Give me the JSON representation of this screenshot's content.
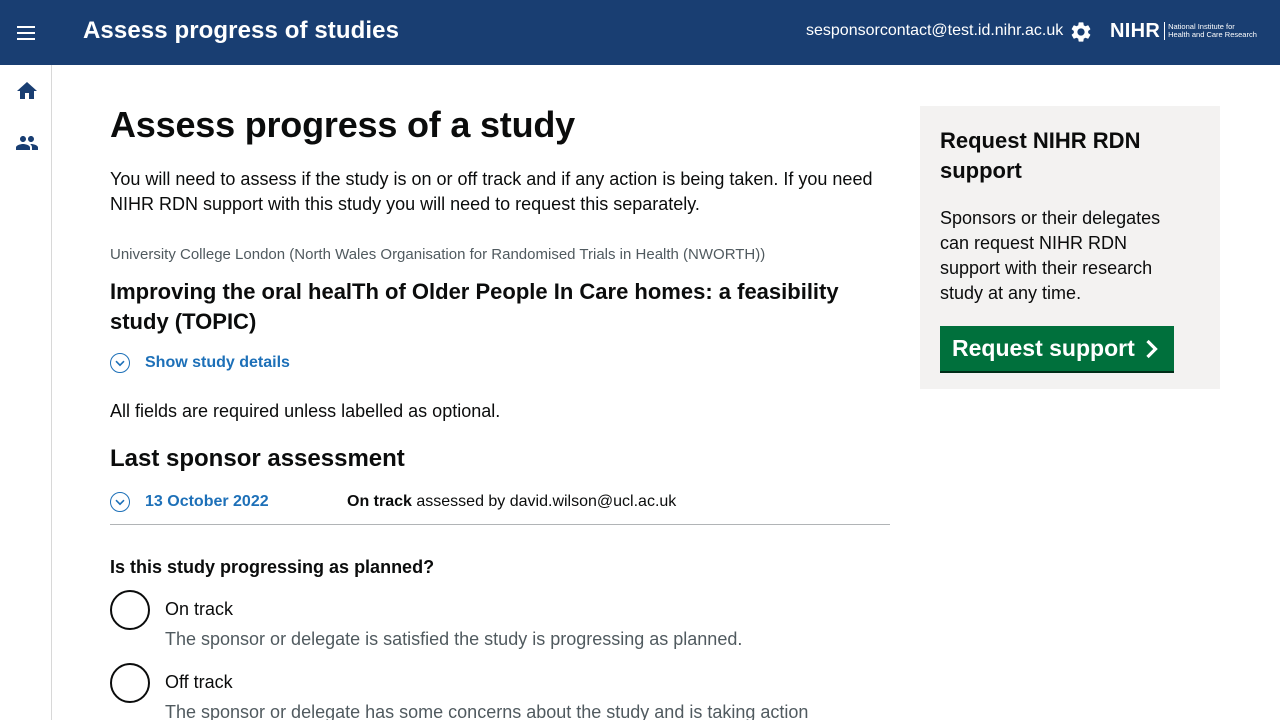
{
  "header": {
    "app_title": "Assess progress of studies",
    "user_email": "sesponsorcontact@test.id.nihr.ac.uk",
    "logo_main": "NIHR",
    "logo_sub_line1": "National Institute for",
    "logo_sub_line2": "Health and Care Research"
  },
  "sidenav": {
    "items": [
      {
        "icon": "home-icon"
      },
      {
        "icon": "people-icon"
      }
    ]
  },
  "main": {
    "page_title": "Assess progress of a study",
    "intro": "You will need to assess if the study is on or off track and if any action is being taken. If you need NIHR RDN support with this study you will need to request this separately.",
    "organisation": "University College London (North Wales Organisation for Randomised Trials in Health (NWORTH))",
    "study_title": "Improving the oral healTh of Older People In Care homes: a feasibility study (TOPIC)",
    "show_details_label": "Show study details",
    "required_note": "All fields are required unless labelled as optional.",
    "last_assessment_heading": "Last sponsor assessment",
    "last_assessment": {
      "date": "13 October 2022",
      "status": "On track",
      "assessed_by_text": " assessed by david.wilson@ucl.ac.uk"
    },
    "question": "Is this study progressing as planned?",
    "options": [
      {
        "label": "On track",
        "hint": "The sponsor or delegate is satisfied the study is progressing as planned."
      },
      {
        "label": "Off track",
        "hint": "The sponsor or delegate has some concerns about the study and is taking action"
      }
    ]
  },
  "aside": {
    "title": "Request NIHR RDN support",
    "text": "Sponsors or their delegates can request NIHR RDN support with their research study at any time.",
    "button_label": "Request support"
  },
  "colors": {
    "header_bg": "#193e72",
    "link": "#1d70b8",
    "button_green": "#00703c",
    "aside_bg": "#f3f2f1"
  }
}
